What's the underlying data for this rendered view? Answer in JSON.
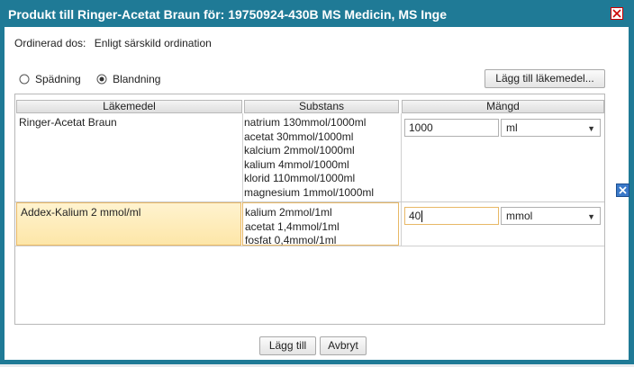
{
  "window": {
    "title": "Produkt till Ringer-Acetat Braun  för: 19750924-430B MS Medicin, MS Inge",
    "accent_color": "#1f7a96",
    "close_icon": "close-icon"
  },
  "ordination": {
    "label": "Ordinerad dos:",
    "value": "Enligt särskild ordination"
  },
  "mode": {
    "options": [
      {
        "label": "Spädning",
        "selected": false
      },
      {
        "label": "Blandning",
        "selected": true
      }
    ]
  },
  "add_drug_button": "Lägg till läkemedel...",
  "table": {
    "headers": [
      "Läkemedel",
      "Substans",
      "Mängd"
    ],
    "rows": [
      {
        "drug": "Ringer-Acetat Braun",
        "substances": [
          "natrium 130mmol/1000ml",
          "acetat 30mmol/1000ml",
          "kalcium 2mmol/1000ml",
          "kalium 4mmol/1000ml",
          "klorid 110mmol/1000ml",
          "magnesium 1mmol/1000ml"
        ],
        "amount": "1000",
        "unit": "ml"
      },
      {
        "drug": "Addex-Kalium 2 mmol/ml",
        "substances": [
          "kalium 2mmol/1ml",
          "acetat 1,4mmol/1ml",
          "fosfat 0,4mmol/1ml"
        ],
        "amount": "40",
        "unit": "mmol",
        "selected": true
      }
    ]
  },
  "footer": {
    "add_label": "Lägg till",
    "cancel_label": "Avbryt"
  }
}
